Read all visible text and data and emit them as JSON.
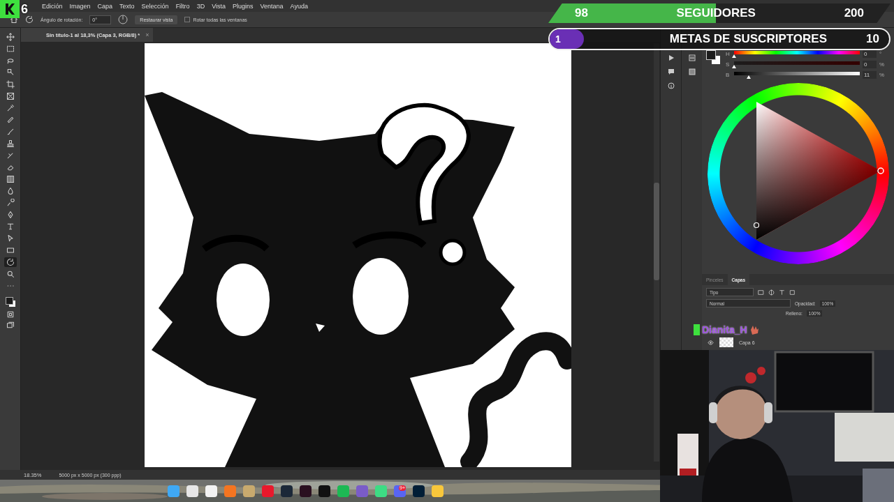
{
  "stream_overlay": {
    "logo_count": "6",
    "followers": {
      "current": "98",
      "label": "SEGUIDORES",
      "goal": "200",
      "level": 0.49
    },
    "subs": {
      "current": "1",
      "label": "METAS DE SUSCRIPTORES",
      "goal": "10",
      "level": 0.1
    },
    "chat_user": "Dianita_H"
  },
  "menu": [
    "Edición",
    "Imagen",
    "Capa",
    "Texto",
    "Selección",
    "Filtro",
    "3D",
    "Vista",
    "Plugins",
    "Ventana",
    "Ayuda"
  ],
  "options_bar": {
    "angle_label": "Ángulo de rotación:",
    "angle_value": "0°",
    "reset_button": "Restaurar vista",
    "rotate_all": {
      "label": "Rotar todas las ventanas",
      "checked": false
    }
  },
  "document_tab": {
    "title": "Sin título-1 al 18,3% (Capa 3, RGB/8) *",
    "close": "×"
  },
  "tools": [
    {
      "kind": "move",
      "selected": false
    },
    {
      "kind": "marquee",
      "selected": false
    },
    {
      "kind": "lasso",
      "selected": false
    },
    {
      "kind": "select",
      "selected": false
    },
    {
      "kind": "crop",
      "selected": false
    },
    {
      "kind": "frame",
      "selected": false
    },
    {
      "kind": "eyedropper",
      "selected": false
    },
    {
      "kind": "healing",
      "selected": false
    },
    {
      "kind": "brush",
      "selected": false
    },
    {
      "kind": "stamp",
      "selected": false
    },
    {
      "kind": "history",
      "selected": false
    },
    {
      "kind": "eraser",
      "selected": false
    },
    {
      "kind": "gradient",
      "selected": false
    },
    {
      "kind": "blur",
      "selected": false
    },
    {
      "kind": "dodge",
      "selected": false
    },
    {
      "kind": "pen",
      "selected": false
    },
    {
      "kind": "type",
      "selected": false
    },
    {
      "kind": "path-select",
      "selected": false
    },
    {
      "kind": "rectangle",
      "selected": false
    },
    {
      "kind": "rotate",
      "selected": true
    },
    {
      "kind": "zoom",
      "selected": false
    },
    {
      "kind": "more",
      "selected": false
    }
  ],
  "color_panel": {
    "sliders": [
      {
        "label": "H",
        "value": "0",
        "unit": "°",
        "level": 0,
        "kind": "hue"
      },
      {
        "label": "S",
        "value": "0",
        "unit": "%",
        "level": 0,
        "kind": "saturation"
      },
      {
        "label": "B",
        "value": "11",
        "unit": "%",
        "level": 0.11,
        "kind": "brightness"
      }
    ]
  },
  "layers_panel": {
    "tabs": [
      {
        "label": "Pinceles",
        "selected": false
      },
      {
        "label": "Capas",
        "selected": true
      }
    ],
    "filter": "Tipo",
    "blend_mode": "Normal",
    "opacity_label": "Opacidad:",
    "opacity": "100%",
    "fill_label": "Relleno:",
    "fill": "100%",
    "layers": [
      {
        "name": "Capa 6",
        "visible": true
      }
    ]
  },
  "status_bar": {
    "zoom": "18.35%",
    "doc_info": "5000 px x 5000 px (300 ppp)"
  },
  "taskbar": {
    "apps": [
      {
        "color": "#3fa9f5"
      },
      {
        "color": "#e6e6e6"
      },
      {
        "color": "#f2f2f2"
      },
      {
        "color": "#f47521"
      },
      {
        "color": "#c8aa6e"
      },
      {
        "color": "#e8192c"
      },
      {
        "color": "#1b2838"
      },
      {
        "color": "#2a1020"
      },
      {
        "color": "#111111"
      },
      {
        "color": "#1db954"
      },
      {
        "color": "#7a5cc8"
      },
      {
        "color": "#3ddc84"
      },
      {
        "color": "#5865f2",
        "badge": "9+"
      },
      {
        "color": "#001e36"
      },
      {
        "color": "#f8c73b"
      }
    ]
  }
}
